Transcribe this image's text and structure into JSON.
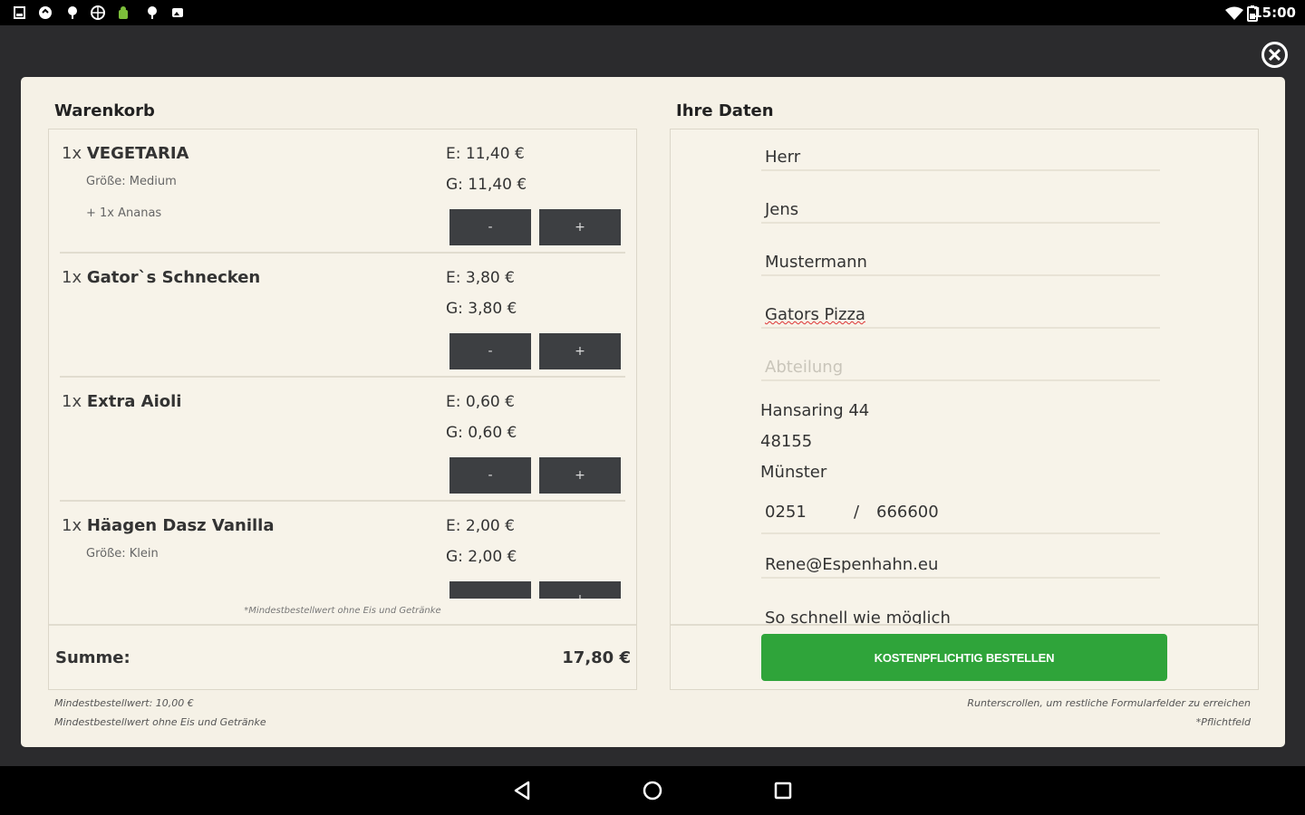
{
  "status_bar": {
    "time": "15:00"
  },
  "cart": {
    "title": "Warenkorb",
    "items": [
      {
        "qty": "1x",
        "name": "VEGETARIA",
        "subs": [
          "Größe: Medium",
          "+ 1x Ananas"
        ],
        "price_e": "E: 11,40 €",
        "price_g": "G: 11,40 €",
        "minus": "-",
        "plus": "+"
      },
      {
        "qty": "1x",
        "name": "Gator`s Schnecken",
        "subs": [],
        "price_e": "E: 3,80 €",
        "price_g": "G: 3,80 €",
        "minus": "-",
        "plus": "+"
      },
      {
        "qty": "1x",
        "name": "Extra Aioli",
        "subs": [],
        "price_e": "E: 0,60 €",
        "price_g": "G: 0,60 €",
        "minus": "-",
        "plus": "+"
      },
      {
        "qty": "1x",
        "name": "Häagen Dasz Vanilla",
        "subs": [
          "Größe: Klein"
        ],
        "price_e": "E: 2,00 €",
        "price_g": "G: 2,00 €",
        "minus": "-",
        "plus": "+"
      }
    ],
    "note": "*Mindestbestellwert ohne Eis und Getränke",
    "sum_label": "Summe:",
    "sum_value": "17,80 €"
  },
  "data": {
    "title": "Ihre Daten",
    "salutation": "Herr",
    "first_name": "Jens",
    "last_name": "Mustermann",
    "company": "Gators Pizza",
    "department_placeholder": "Abteilung",
    "street": "Hansaring 44",
    "zip": "48155",
    "city": "Münster",
    "phone_prefix": "0251",
    "phone_sep": "/",
    "phone_number": "666600",
    "email": "Rene@Espenhahn.eu",
    "delivery_time": "So schnell wie möglich",
    "order_button": "KOSTENPFLICHTIG BESTELLEN"
  },
  "footer": {
    "left_line1": "Mindestbestellwert: 10,00 €",
    "left_line2": "Mindestbestellwert ohne Eis und Getränke",
    "right_line1": "Runterscrollen, um restliche Formularfelder zu erreichen",
    "right_line2": "*Pflichtfeld"
  },
  "colors": {
    "accent_green": "#2fa43a",
    "panel_bg": "#f5f1e6",
    "button_dark": "#3d3f42"
  }
}
